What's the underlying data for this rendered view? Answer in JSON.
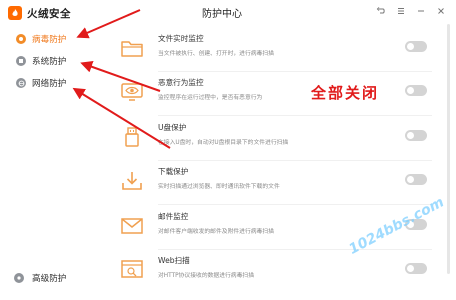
{
  "app": {
    "brand": "火绒安全",
    "title": "防护中心"
  },
  "window_controls": [
    {
      "name": "back-icon",
      "glyph": "↶"
    },
    {
      "name": "menu-icon",
      "glyph": "☰"
    },
    {
      "name": "minimize-icon",
      "glyph": "—"
    },
    {
      "name": "close-icon",
      "glyph": "✕"
    }
  ],
  "sidebar": {
    "items": [
      {
        "label": "病毒防护",
        "active": true
      },
      {
        "label": "系统防护",
        "active": false
      },
      {
        "label": "网络防护",
        "active": false
      }
    ],
    "bottom": {
      "label": "高级防护"
    }
  },
  "features": [
    {
      "title": "文件实时监控",
      "desc": "当文件被执行、创建、打开时，进行病毒扫描",
      "icon": "folder-icon",
      "enabled": false
    },
    {
      "title": "恶意行为监控",
      "desc": "监控程序在运行过程中，是否有恶意行为",
      "icon": "eye-monitor-icon",
      "enabled": false
    },
    {
      "title": "U盘保护",
      "desc": "在接入U盘时，自动对U盘根目录下的文件进行扫描",
      "icon": "usb-icon",
      "enabled": false
    },
    {
      "title": "下载保护",
      "desc": "实时扫描通过浏览器、即时通讯软件下载的文件",
      "icon": "download-icon",
      "enabled": false
    },
    {
      "title": "邮件监控",
      "desc": "对邮件客户端收发的邮件及附件进行病毒扫描",
      "icon": "mail-icon",
      "enabled": false
    },
    {
      "title": "Web扫描",
      "desc": "对HTTP协议接收的数据进行病毒扫描",
      "icon": "web-scan-icon",
      "enabled": false
    }
  ],
  "annotation": {
    "text": "全部关闭"
  },
  "watermark": {
    "text": "1024bbs.com"
  },
  "colors": {
    "accent": "#f28c28",
    "annotation_red": "#e11b1b",
    "toggle_off": "#d4d4d4",
    "icon_orange": "#f0a050"
  }
}
